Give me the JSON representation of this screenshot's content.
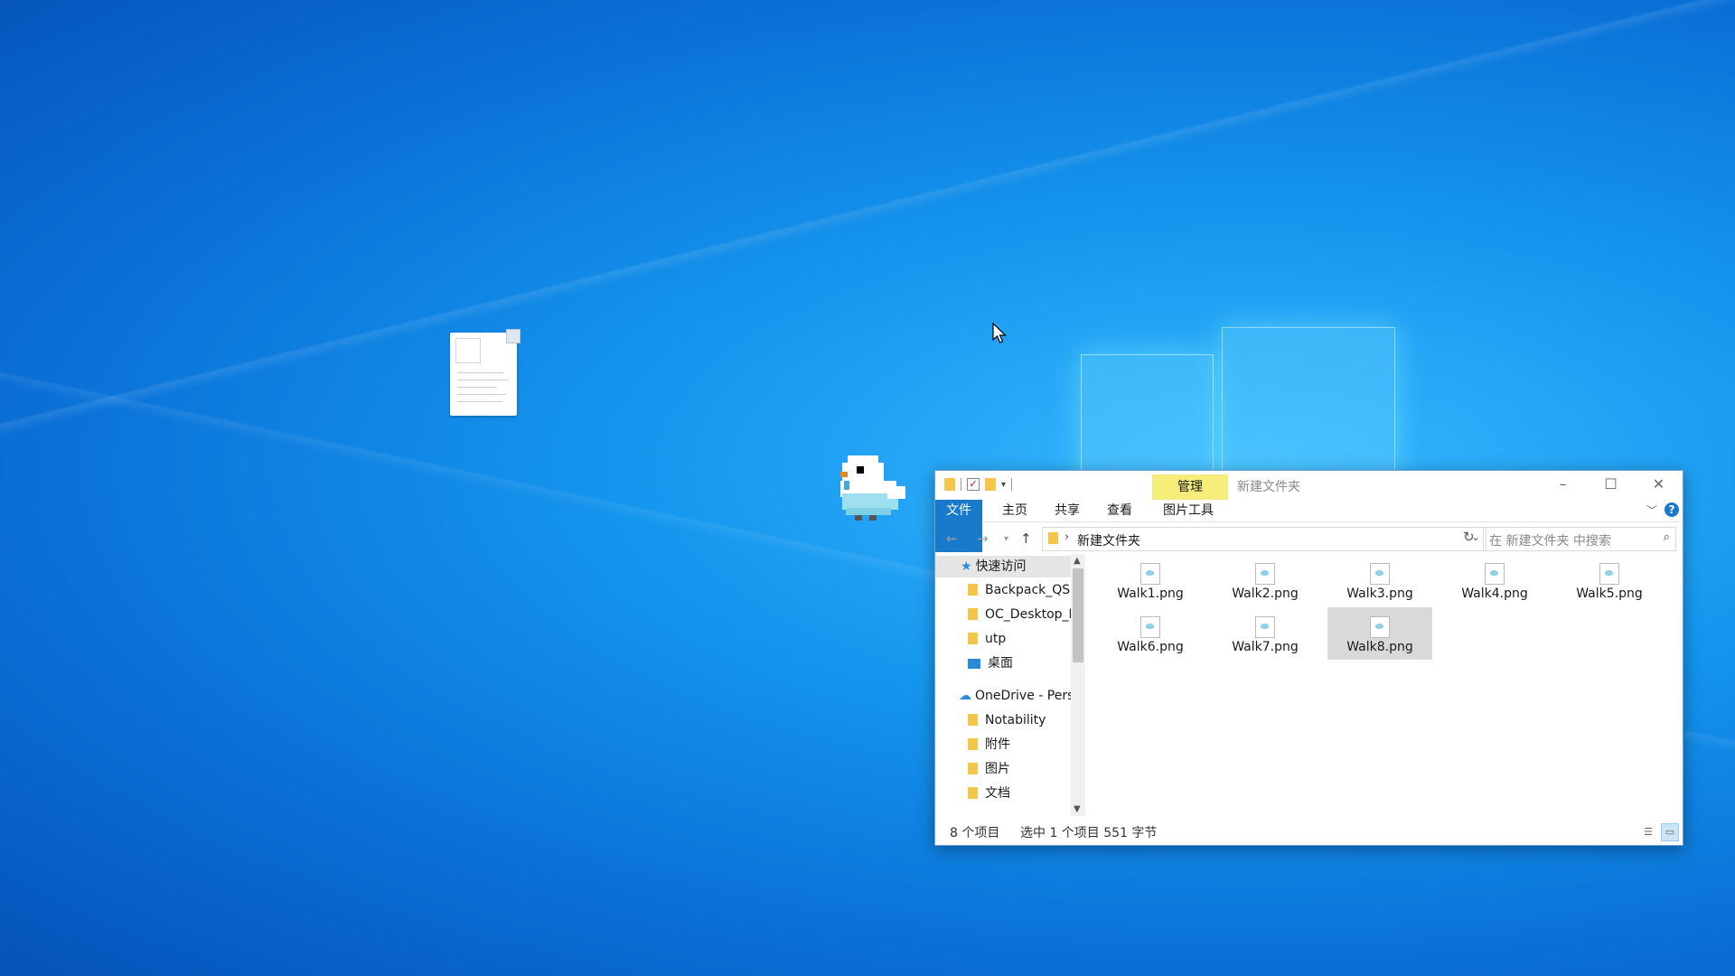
{
  "explorer": {
    "title": "新建文件夹",
    "manage_label": "管理",
    "tabs": [
      "文件",
      "主页",
      "共享",
      "查看",
      "图片工具"
    ],
    "address": {
      "path": "新建文件夹"
    },
    "search": {
      "placeholder": "在 新建文件夹 中搜索"
    },
    "nav_items": [
      {
        "label": "快速访问",
        "icon": "star-icon"
      },
      {
        "label": "Backpack_QSC",
        "icon": "folder-icon"
      },
      {
        "label": "OC_Desktop_N",
        "icon": "folder-icon"
      },
      {
        "label": "utp",
        "icon": "folder-icon"
      },
      {
        "label": "桌面",
        "icon": "desktop-icon"
      },
      {
        "label": "OneDrive - Pers",
        "icon": "cloud-icon"
      },
      {
        "label": "Notability",
        "icon": "folder-icon"
      },
      {
        "label": "附件",
        "icon": "folder-icon"
      },
      {
        "label": "图片",
        "icon": "folder-icon"
      },
      {
        "label": "文档",
        "icon": "folder-icon"
      }
    ],
    "files": [
      {
        "name": "Walk1.png",
        "selected": false
      },
      {
        "name": "Walk2.png",
        "selected": false
      },
      {
        "name": "Walk3.png",
        "selected": false
      },
      {
        "name": "Walk4.png",
        "selected": false
      },
      {
        "name": "Walk5.png",
        "selected": false
      },
      {
        "name": "Walk6.png",
        "selected": false
      },
      {
        "name": "Walk7.png",
        "selected": false
      },
      {
        "name": "Walk8.png",
        "selected": true
      }
    ],
    "status": {
      "count": "8 个项目",
      "selection": "选中 1 个项目  551 字节"
    }
  },
  "colors": {
    "accent": "#1979ca",
    "manage_bg": "#f5ec7a",
    "folder": "#f3c64a"
  }
}
